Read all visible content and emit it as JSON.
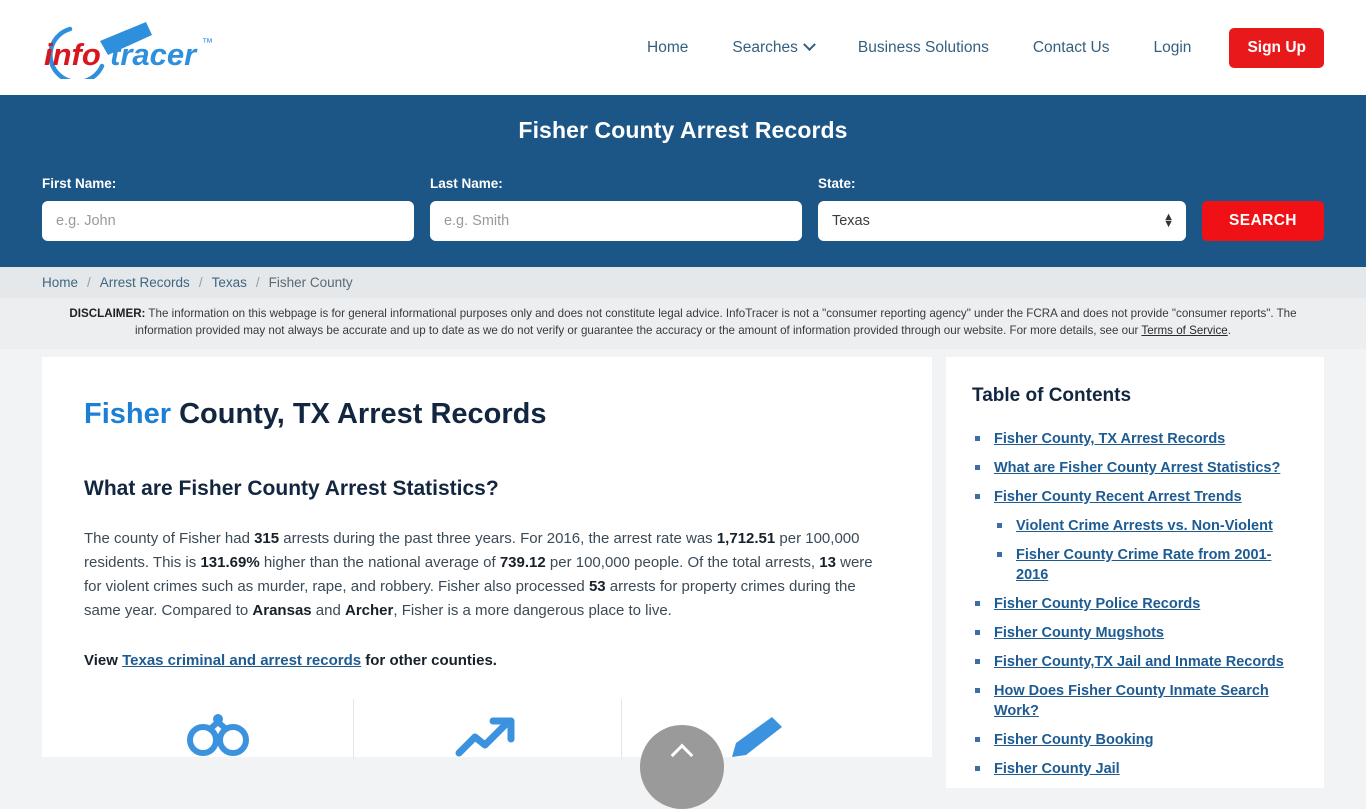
{
  "brand": {
    "name_part1": "info",
    "name_part2": "tracer",
    "tm": "™",
    "colors": {
      "red": "#d9161e",
      "blue": "#2e8fdd",
      "header_blue": "#1b5687",
      "accent_red": "#e8191b"
    }
  },
  "nav": {
    "items": [
      {
        "label": "Home",
        "icon": "",
        "has_dropdown": false
      },
      {
        "label": "Searches",
        "icon": "chevron-down-icon",
        "has_dropdown": true
      },
      {
        "label": "Business Solutions",
        "icon": "",
        "has_dropdown": false
      },
      {
        "label": "Contact Us",
        "icon": "",
        "has_dropdown": false
      },
      {
        "label": "Login",
        "icon": "",
        "has_dropdown": false
      }
    ],
    "signup_label": "Sign Up"
  },
  "hero": {
    "title": "Fisher County Arrest Records",
    "fields": {
      "first": {
        "label": "First Name:",
        "placeholder": "e.g. John",
        "value": ""
      },
      "last": {
        "label": "Last Name:",
        "placeholder": "e.g. Smith",
        "value": ""
      },
      "state": {
        "label": "State:",
        "selected": "Texas",
        "options": [
          "Texas"
        ]
      }
    },
    "search_label": "SEARCH"
  },
  "breadcrumb": {
    "separator": "/",
    "items": [
      {
        "label": "Home",
        "current": false
      },
      {
        "label": "Arrest Records",
        "current": false
      },
      {
        "label": "Texas",
        "current": false
      },
      {
        "label": "Fisher County",
        "current": true
      }
    ]
  },
  "disclaimer": {
    "label": "DISCLAIMER:",
    "text": " The information on this webpage is for general informational purposes only and does not constitute legal advice. InfoTracer is not a \"consumer reporting agency\" under the FCRA and does not provide \"consumer reports\". The information provided may not always be accurate and up to date as we do not verify or guarantee the accuracy or the amount of information provided through our website. For more details, see our ",
    "link": "Terms of Service",
    "tail": "."
  },
  "article": {
    "title_accent": "Fisher",
    "title_rest": " County, TX Arrest Records",
    "subtitle": "What are Fisher County Arrest Statistics?",
    "paragraph": {
      "p1": "The county of Fisher had ",
      "b1": "315",
      "p2": " arrests during the past three years. For 2016, the arrest rate was ",
      "b2": "1,712.51",
      "p3": " per 100,000 residents. This is ",
      "b3": "131.69%",
      "p4": " higher than the national average of ",
      "b4": "739.12",
      "p5": " per 100,000 people. Of the total arrests, ",
      "b5": "13",
      "p6": " were for violent crimes such as murder, rape, and robbery. Fisher also processed ",
      "b6": "53",
      "p7": " arrests for property crimes during the same year. Compared to ",
      "b7": "Aransas",
      "p8": " and ",
      "b8": "Archer",
      "p9": ", Fisher is a more dangerous place to live."
    },
    "view_prefix": "View ",
    "view_link": "Texas criminal and arrest records",
    "view_suffix": " for other counties.",
    "icons": [
      {
        "name": "handcuffs-icon"
      },
      {
        "name": "trending-arrow-icon"
      },
      {
        "name": "pen-icon"
      }
    ]
  },
  "toc": {
    "heading": "Table of Contents",
    "items": [
      {
        "label": "Fisher County, TX Arrest Records",
        "sub": false
      },
      {
        "label": "What are Fisher County Arrest Statistics?",
        "sub": false
      },
      {
        "label": "Fisher County Recent Arrest Trends",
        "sub": false
      },
      {
        "label": "Violent Crime Arrests vs. Non-Violent",
        "sub": true
      },
      {
        "label": "Fisher County Crime Rate from 2001-2016",
        "sub": true
      },
      {
        "label": "Fisher County Police Records",
        "sub": false
      },
      {
        "label": "Fisher County Mugshots",
        "sub": false
      },
      {
        "label": "Fisher County,TX Jail and Inmate Records",
        "sub": false
      },
      {
        "label": "How Does Fisher County Inmate Search Work?",
        "sub": false
      },
      {
        "label": "Fisher County Booking",
        "sub": false
      },
      {
        "label": "Fisher County Jail",
        "sub": false
      }
    ]
  },
  "scroll_top": {
    "aria": "Scroll to top"
  }
}
